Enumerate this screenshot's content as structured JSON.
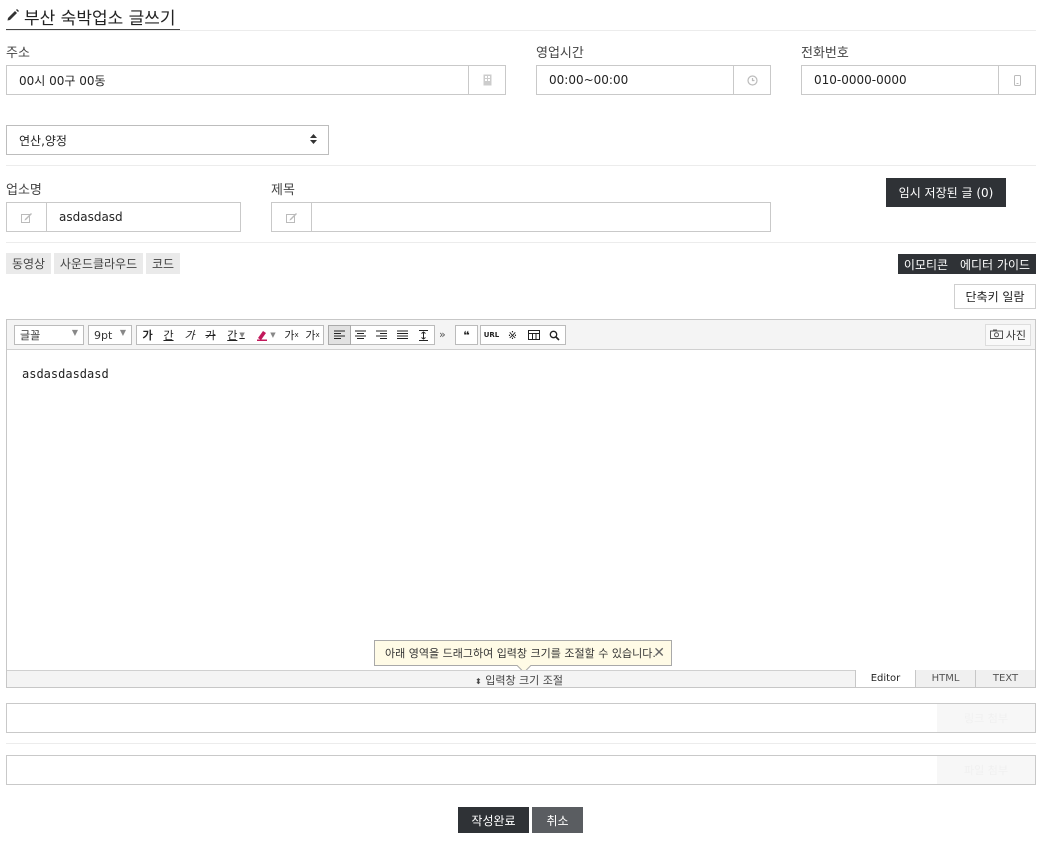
{
  "page_title": "부산 숙박업소 글쓰기",
  "address": {
    "label": "주소",
    "value": "00시 00구 00동"
  },
  "hours": {
    "label": "영업시간",
    "value": "00:00~00:00"
  },
  "phone": {
    "label": "전화번호",
    "value": "010-0000-0000"
  },
  "region_select": {
    "value": "연산,양정"
  },
  "business_name": {
    "label": "업소명",
    "value": "asdasdasd"
  },
  "subject": {
    "label": "제목",
    "value": ""
  },
  "temp_saved_button": "임시 저장된 글 (0)",
  "media_tabs": [
    "동영상",
    "사운드클라우드",
    "코드"
  ],
  "emoticon_button": "이모티콘",
  "editor_guide_button": "에디터 가이드",
  "shortcut_button": "단축키 일람",
  "toolbar": {
    "font_select": "글꼴",
    "size_select": "9pt",
    "photo_label": "사진",
    "quote_label": "❝",
    "url_label": "URL"
  },
  "editor": {
    "content": "asdasdasdasd",
    "tooltip": "아래 영역을 드래그하여 입력창 크기를 조절할 수 있습니다.",
    "resize_label": "입력창 크기 조절",
    "modes": [
      "Editor",
      "HTML",
      "TEXT"
    ],
    "active_mode": "Editor"
  },
  "link1_button": "링크 첨부",
  "link2_button": "파일 첨부",
  "submit_button": "작성완료",
  "cancel_button": "취소"
}
